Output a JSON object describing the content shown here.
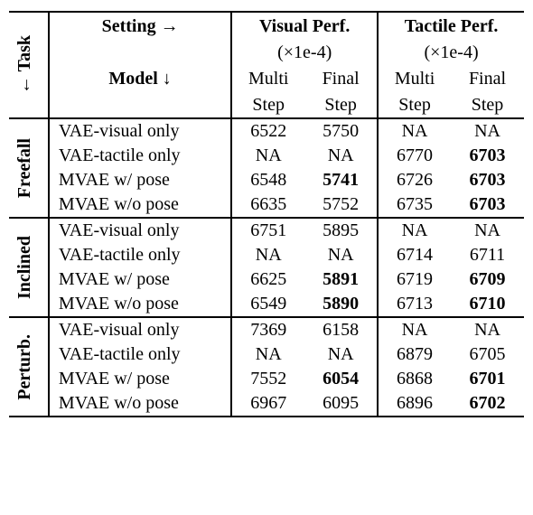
{
  "headers": {
    "task": "← Task",
    "setting_arrow": "Setting →",
    "model_arrow": "Model ↓",
    "visual_title": "Visual Perf.",
    "tactile_title": "Tactile Perf.",
    "scale": "(×1e-4)",
    "multi": "Multi",
    "final": "Final",
    "step": "Step"
  },
  "groups": [
    {
      "name": "Freefall",
      "rows": [
        {
          "model": "VAE-visual only",
          "v_multi": "6522",
          "v_final": "5750",
          "t_multi": "NA",
          "t_final": "NA",
          "bold": {}
        },
        {
          "model": "VAE-tactile only",
          "v_multi": "NA",
          "v_final": "NA",
          "t_multi": "6770",
          "t_final": "6703",
          "bold": {
            "t_final": true
          }
        },
        {
          "model": "MVAE w/ pose",
          "v_multi": "6548",
          "v_final": "5741",
          "t_multi": "6726",
          "t_final": "6703",
          "bold": {
            "v_final": true,
            "t_final": true
          }
        },
        {
          "model": "MVAE w/o pose",
          "v_multi": "6635",
          "v_final": "5752",
          "t_multi": "6735",
          "t_final": "6703",
          "bold": {
            "t_final": true
          }
        }
      ]
    },
    {
      "name": "Inclined",
      "rows": [
        {
          "model": "VAE-visual only",
          "v_multi": "6751",
          "v_final": "5895",
          "t_multi": "NA",
          "t_final": "NA",
          "bold": {}
        },
        {
          "model": "VAE-tactile only",
          "v_multi": "NA",
          "v_final": "NA",
          "t_multi": "6714",
          "t_final": "6711",
          "bold": {}
        },
        {
          "model": "MVAE w/ pose",
          "v_multi": "6625",
          "v_final": "5891",
          "t_multi": "6719",
          "t_final": "6709",
          "bold": {
            "v_final": true,
            "t_final": true
          }
        },
        {
          "model": "MVAE w/o pose",
          "v_multi": "6549",
          "v_final": "5890",
          "t_multi": "6713",
          "t_final": "6710",
          "bold": {
            "v_final": true,
            "t_final": true
          }
        }
      ]
    },
    {
      "name": "Perturb.",
      "rows": [
        {
          "model": "VAE-visual only",
          "v_multi": "7369",
          "v_final": "6158",
          "t_multi": "NA",
          "t_final": "NA",
          "bold": {}
        },
        {
          "model": "VAE-tactile only",
          "v_multi": "NA",
          "v_final": "NA",
          "t_multi": "6879",
          "t_final": "6705",
          "bold": {}
        },
        {
          "model": "MVAE w/ pose",
          "v_multi": "7552",
          "v_final": "6054",
          "t_multi": "6868",
          "t_final": "6701",
          "bold": {
            "v_final": true,
            "t_final": true
          }
        },
        {
          "model": "MVAE w/o pose",
          "v_multi": "6967",
          "v_final": "6095",
          "t_multi": "6896",
          "t_final": "6702",
          "bold": {
            "t_final": true
          }
        }
      ]
    }
  ],
  "chart_data": {
    "type": "table",
    "title": "Visual and Tactile Performance (×1e-4) by Task and Model",
    "columns": [
      "Task",
      "Model",
      "Visual Multi Step",
      "Visual Final Step",
      "Tactile Multi Step",
      "Tactile Final Step"
    ],
    "rows": [
      [
        "Freefall",
        "VAE-visual only",
        6522,
        5750,
        null,
        null
      ],
      [
        "Freefall",
        "VAE-tactile only",
        null,
        null,
        6770,
        6703
      ],
      [
        "Freefall",
        "MVAE w/ pose",
        6548,
        5741,
        6726,
        6703
      ],
      [
        "Freefall",
        "MVAE w/o pose",
        6635,
        5752,
        6735,
        6703
      ],
      [
        "Inclined",
        "VAE-visual only",
        6751,
        5895,
        null,
        null
      ],
      [
        "Inclined",
        "VAE-tactile only",
        null,
        null,
        6714,
        6711
      ],
      [
        "Inclined",
        "MVAE w/ pose",
        6625,
        5891,
        6719,
        6709
      ],
      [
        "Inclined",
        "MVAE w/o pose",
        6549,
        5890,
        6713,
        6710
      ],
      [
        "Perturb.",
        "VAE-visual only",
        7369,
        6158,
        null,
        null
      ],
      [
        "Perturb.",
        "VAE-tactile only",
        null,
        null,
        6879,
        6705
      ],
      [
        "Perturb.",
        "MVAE w/ pose",
        7552,
        6054,
        6868,
        6701
      ],
      [
        "Perturb.",
        "MVAE w/o pose",
        6967,
        6095,
        6896,
        6702
      ]
    ],
    "scale": 0.0001
  }
}
